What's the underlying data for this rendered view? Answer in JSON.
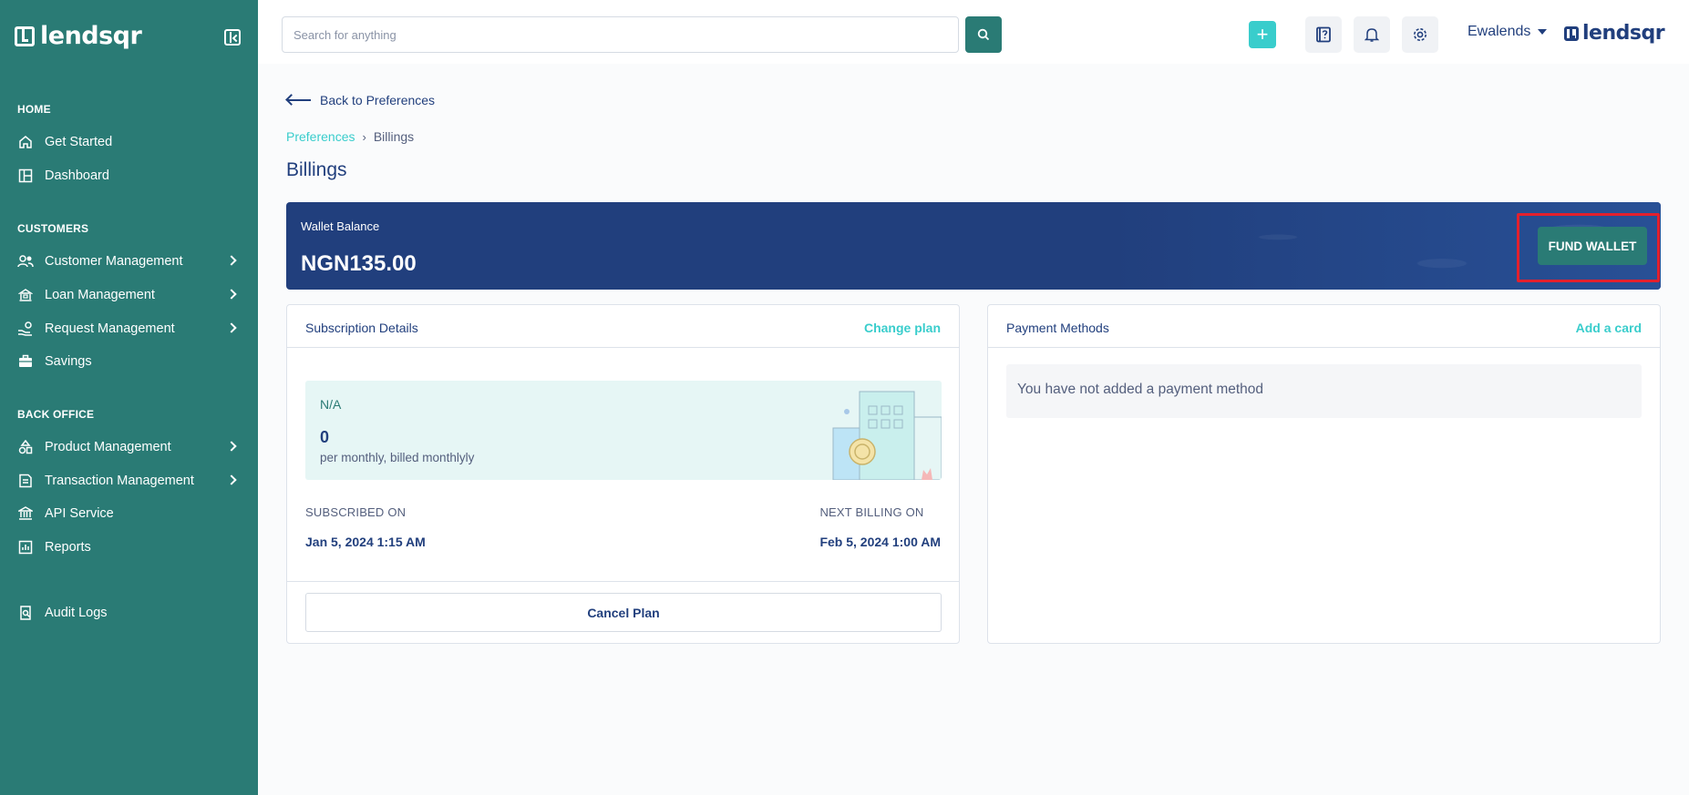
{
  "sidebar": {
    "brand": "lendsqr",
    "sections": {
      "home": "HOME",
      "customers": "CUSTOMERS",
      "back_office": "BACK OFFICE"
    },
    "items": {
      "get_started": "Get Started",
      "dashboard": "Dashboard",
      "customer_management": "Customer Management",
      "loan_management": "Loan Management",
      "request_management": "Request Management",
      "savings": "Savings",
      "product_management": "Product Management",
      "transaction_management": "Transaction Management",
      "api_service": "API Service",
      "reports": "Reports",
      "audit_logs": "Audit Logs"
    }
  },
  "topbar": {
    "search_placeholder": "Search for anything",
    "user_name": "Ewalends",
    "brand": "lendsqr"
  },
  "page": {
    "back_label": "Back to Preferences",
    "breadcrumb": {
      "parent": "Preferences",
      "current": "Billings"
    },
    "title": "Billings"
  },
  "wallet": {
    "label": "Wallet Balance",
    "amount": "NGN135.00",
    "fund_button": "FUND WALLET"
  },
  "subscription": {
    "title": "Subscription Details",
    "action": "Change plan",
    "plan_name": "N/A",
    "price": "0",
    "price_desc": "per monthly, billed monthlyly",
    "subscribed_on_label": "SUBSCRIBED ON",
    "subscribed_on": "Jan 5, 2024 1:15 AM",
    "next_billing_label": "NEXT BILLING ON",
    "next_billing": "Feb 5, 2024 1:00 AM",
    "cancel_button": "Cancel Plan"
  },
  "payment": {
    "title": "Payment Methods",
    "action": "Add a card",
    "empty_text": "You have not added a payment method"
  },
  "colors": {
    "sidebar": "#2a7b75",
    "primary_text": "#213f7d",
    "accent": "#39cdcc",
    "wallet_bg": "#213f7d",
    "highlight": "#e3202d"
  }
}
